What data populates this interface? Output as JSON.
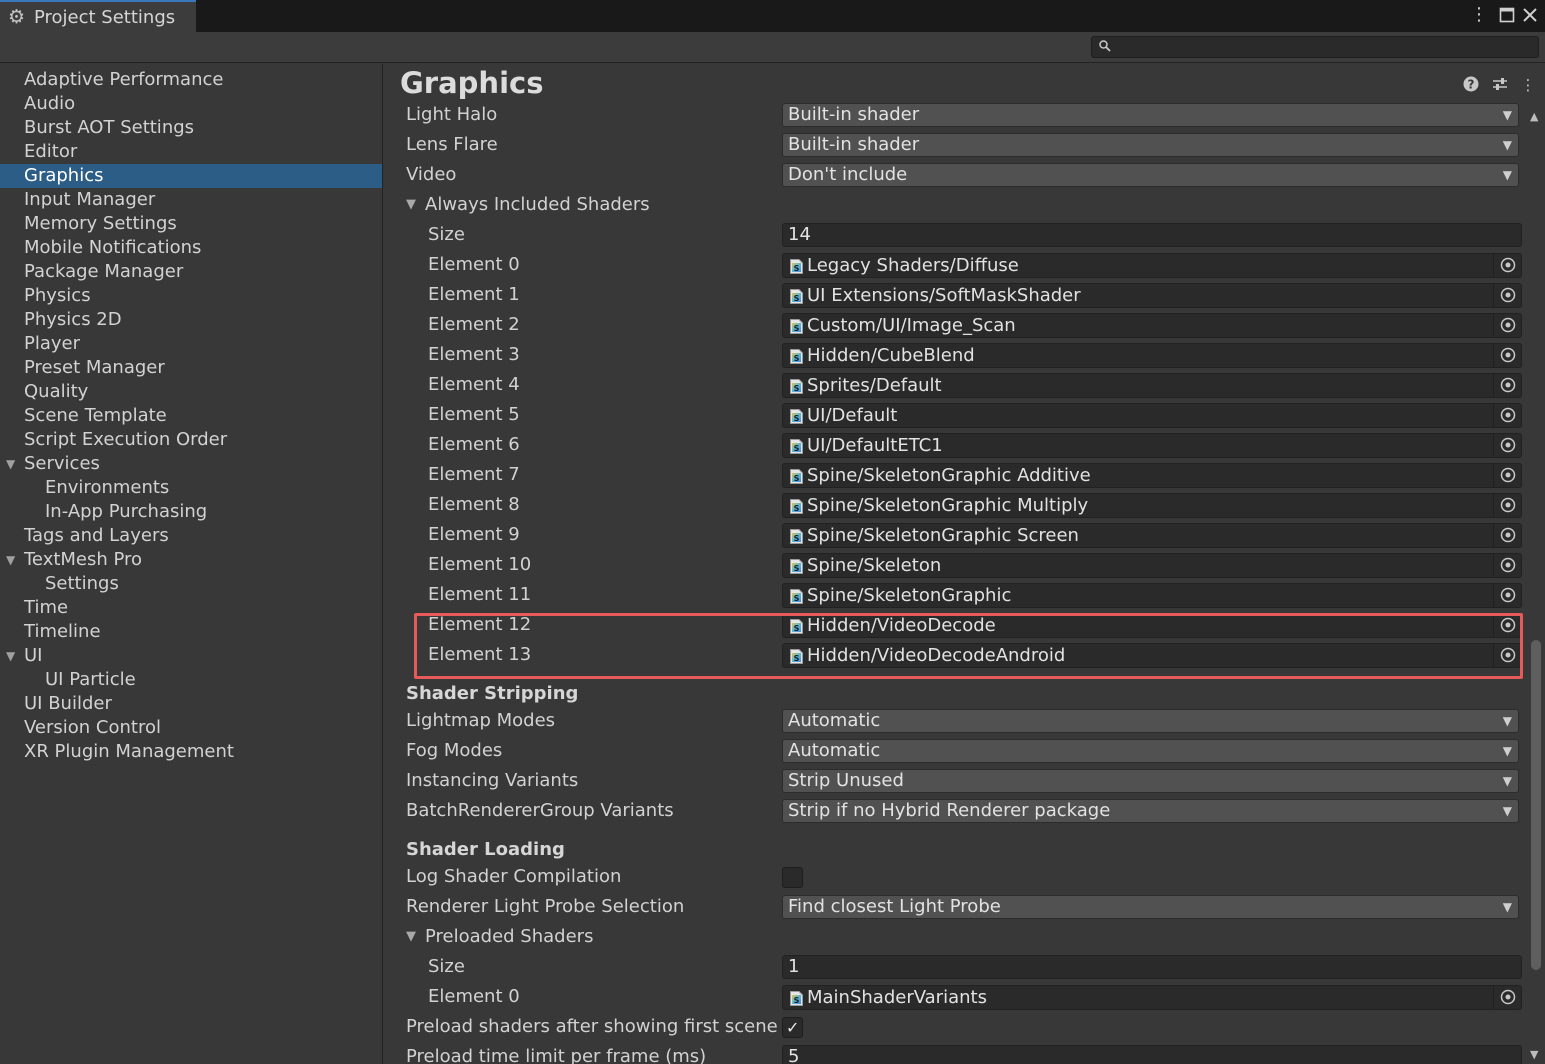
{
  "window": {
    "tab_title": "Project Settings",
    "menu_icon": "kebab-menu-icon",
    "maximize_icon": "maximize-icon",
    "close_icon": "close-icon"
  },
  "search": {
    "placeholder": "",
    "value": ""
  },
  "sidebar": {
    "items": [
      {
        "label": "Adaptive Performance",
        "level": 0
      },
      {
        "label": "Audio",
        "level": 0
      },
      {
        "label": "Burst AOT Settings",
        "level": 0
      },
      {
        "label": "Editor",
        "level": 0
      },
      {
        "label": "Graphics",
        "level": 0,
        "selected": true
      },
      {
        "label": "Input Manager",
        "level": 0
      },
      {
        "label": "Memory Settings",
        "level": 0
      },
      {
        "label": "Mobile Notifications",
        "level": 0
      },
      {
        "label": "Package Manager",
        "level": 0
      },
      {
        "label": "Physics",
        "level": 0
      },
      {
        "label": "Physics 2D",
        "level": 0
      },
      {
        "label": "Player",
        "level": 0
      },
      {
        "label": "Preset Manager",
        "level": 0
      },
      {
        "label": "Quality",
        "level": 0
      },
      {
        "label": "Scene Template",
        "level": 0
      },
      {
        "label": "Script Execution Order",
        "level": 0
      },
      {
        "label": "Services",
        "level": 0,
        "expanded": true
      },
      {
        "label": "Environments",
        "level": 1
      },
      {
        "label": "In-App Purchasing",
        "level": 1
      },
      {
        "label": "Tags and Layers",
        "level": 0
      },
      {
        "label": "TextMesh Pro",
        "level": 0,
        "expanded": true
      },
      {
        "label": "Settings",
        "level": 1
      },
      {
        "label": "Time",
        "level": 0
      },
      {
        "label": "Timeline",
        "level": 0
      },
      {
        "label": "UI",
        "level": 0,
        "expanded": true
      },
      {
        "label": "UI Particle",
        "level": 1
      },
      {
        "label": "UI Builder",
        "level": 0
      },
      {
        "label": "Version Control",
        "level": 0
      },
      {
        "label": "XR Plugin Management",
        "level": 0
      }
    ]
  },
  "main": {
    "title": "Graphics",
    "header_icons": [
      "help-icon",
      "preset-sliders-icon",
      "kebab-menu-icon"
    ],
    "light_halo": {
      "label": "Light Halo",
      "value": "Built-in shader"
    },
    "lens_flare": {
      "label": "Lens Flare",
      "value": "Built-in shader"
    },
    "video": {
      "label": "Video",
      "value": "Don't include"
    },
    "always_included": {
      "label": "Always Included Shaders",
      "size_label": "Size",
      "size": "14",
      "elements": [
        {
          "label": "Element 0",
          "value": "Legacy Shaders/Diffuse"
        },
        {
          "label": "Element 1",
          "value": "UI Extensions/SoftMaskShader"
        },
        {
          "label": "Element 2",
          "value": "Custom/UI/Image_Scan"
        },
        {
          "label": "Element 3",
          "value": "Hidden/CubeBlend"
        },
        {
          "label": "Element 4",
          "value": "Sprites/Default"
        },
        {
          "label": "Element 5",
          "value": "UI/Default"
        },
        {
          "label": "Element 6",
          "value": "UI/DefaultETC1"
        },
        {
          "label": "Element 7",
          "value": "Spine/SkeletonGraphic Additive"
        },
        {
          "label": "Element 8",
          "value": "Spine/SkeletonGraphic Multiply"
        },
        {
          "label": "Element 9",
          "value": "Spine/SkeletonGraphic Screen"
        },
        {
          "label": "Element 10",
          "value": "Spine/Skeleton"
        },
        {
          "label": "Element 11",
          "value": "Spine/SkeletonGraphic"
        },
        {
          "label": "Element 12",
          "value": "Hidden/VideoDecode"
        },
        {
          "label": "Element 13",
          "value": "Hidden/VideoDecodeAndroid"
        }
      ]
    },
    "shader_stripping": {
      "title": "Shader Stripping",
      "lightmap_modes": {
        "label": "Lightmap Modes",
        "value": "Automatic"
      },
      "fog_modes": {
        "label": "Fog Modes",
        "value": "Automatic"
      },
      "instancing_variants": {
        "label": "Instancing Variants",
        "value": "Strip Unused"
      },
      "brg_variants": {
        "label": "BatchRendererGroup Variants",
        "value": "Strip if no Hybrid Renderer package"
      }
    },
    "shader_loading": {
      "title": "Shader Loading",
      "log_compilation": {
        "label": "Log Shader Compilation",
        "checked": false
      },
      "light_probe": {
        "label": "Renderer Light Probe Selection",
        "value": "Find closest Light Probe"
      },
      "preloaded": {
        "label": "Preloaded Shaders",
        "size_label": "Size",
        "size": "1",
        "elements": [
          {
            "label": "Element 0",
            "value": "MainShaderVariants"
          }
        ]
      },
      "preload_after_first": {
        "label": "Preload shaders after showing first scene",
        "checked": true,
        "tick": "✓"
      },
      "preload_time_limit": {
        "label": "Preload time limit per frame (ms)",
        "value": "5"
      }
    }
  },
  "colors": {
    "selection": "#2c5d87",
    "highlight_box": "#e85a5a",
    "background": "#383838"
  }
}
